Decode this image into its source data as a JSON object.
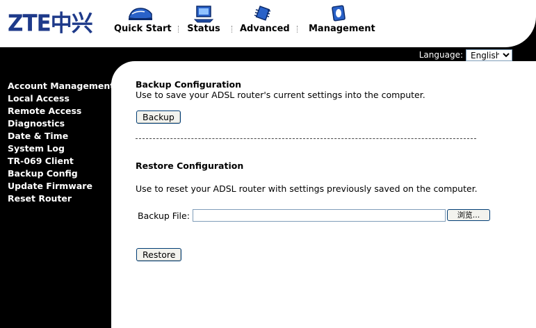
{
  "header": {
    "logo_text": "ZTE中兴",
    "nav": [
      {
        "label": "Quick Start",
        "icon": "quick-start-shoe-icon"
      },
      {
        "label": "Status",
        "icon": "status-monitor-icon"
      },
      {
        "label": "Advanced",
        "icon": "advanced-chip-icon"
      },
      {
        "label": "Management",
        "icon": "management-gear-icon"
      }
    ]
  },
  "language": {
    "label": "Language:",
    "selected": "English"
  },
  "sidebar": {
    "items": [
      {
        "label": "Account Management"
      },
      {
        "label": "Local Access"
      },
      {
        "label": "Remote Access"
      },
      {
        "label": "Diagnostics"
      },
      {
        "label": "Date & Time"
      },
      {
        "label": "System Log"
      },
      {
        "label": "TR-069 Client"
      },
      {
        "label": "Backup Config"
      },
      {
        "label": "Update Firmware"
      },
      {
        "label": "Reset Router"
      }
    ]
  },
  "backup": {
    "title": "Backup Configuration",
    "description": "Use to save your ADSL router's current settings into the computer.",
    "button": "Backup"
  },
  "divider_text": "--------------------------------------------------------------------------------------------------",
  "restore": {
    "title": "Restore Configuration",
    "description": "Use to reset your ADSL router with settings previously saved on the computer.",
    "file_label": "Backup File:",
    "file_value": "",
    "browse_button": "浏览...",
    "button": "Restore"
  },
  "colors": {
    "logo_blue": "#1e3a8a",
    "background_black": "#000000",
    "content_white": "#ffffff"
  }
}
